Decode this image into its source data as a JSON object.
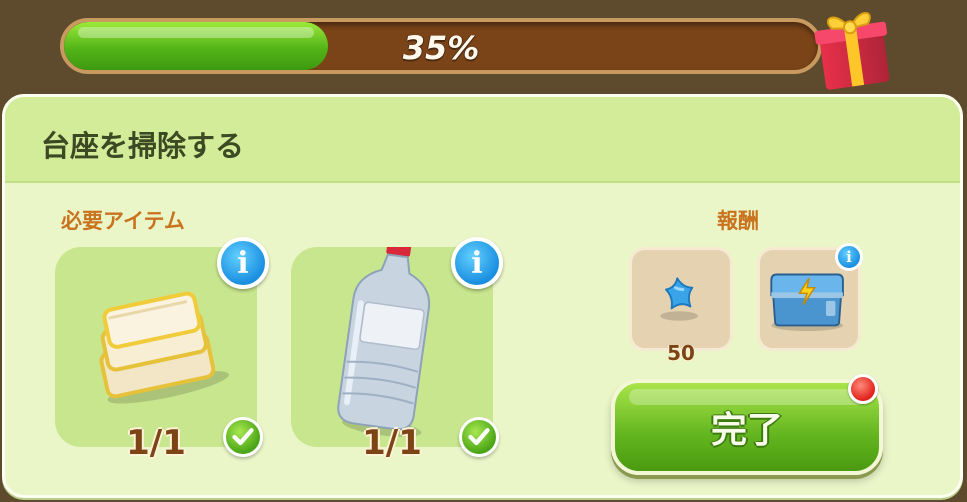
{
  "progress": {
    "value": 0.35,
    "label": "35%"
  },
  "panel": {
    "title": "台座を掃除する",
    "required_label": "必要アイテム",
    "reward_label": "報酬"
  },
  "required_items": [
    {
      "name": "cloth",
      "icon": "folded-cloth-icon",
      "count": "1/1",
      "complete": true
    },
    {
      "name": "bottle",
      "icon": "water-bottle-icon",
      "count": "1/1",
      "complete": true
    }
  ],
  "rewards": [
    {
      "icon": "blue-star-icon",
      "amount": "50"
    },
    {
      "icon": "energy-chest-icon",
      "amount": ""
    }
  ],
  "complete_button": {
    "label": "完了"
  },
  "colors": {
    "progress_fill": "#53b418",
    "progress_track": "#7b4418",
    "panel_bg": "#eaf5c8",
    "header_bg": "#d2ec9a",
    "section_label": "#c9731e",
    "button_green": "#62b51e"
  }
}
